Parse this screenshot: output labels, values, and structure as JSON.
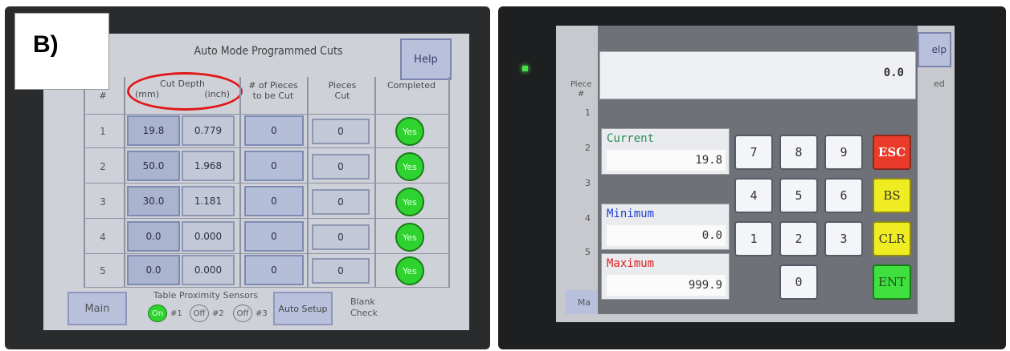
{
  "figure_label": "B)",
  "left_screen": {
    "title": "Auto Mode Programmed Cuts",
    "help_label": "Help",
    "header_row_col": "e\n#",
    "header_cut_depth": "Cut Depth",
    "header_mm": "(mm)",
    "header_inch": "(inch)",
    "header_pieces_to_cut": "# of Pieces\nto be Cut",
    "header_pieces_cut": "Pieces\nCut",
    "header_completed": "Completed",
    "rows": [
      {
        "num": "1",
        "mm": "19.8",
        "inch": "0.779",
        "to_cut": "0",
        "cut": "0",
        "completed": "Yes"
      },
      {
        "num": "2",
        "mm": "50.0",
        "inch": "1.968",
        "to_cut": "0",
        "cut": "0",
        "completed": "Yes"
      },
      {
        "num": "3",
        "mm": "30.0",
        "inch": "1.181",
        "to_cut": "0",
        "cut": "0",
        "completed": "Yes"
      },
      {
        "num": "4",
        "mm": "0.0",
        "inch": "0.000",
        "to_cut": "0",
        "cut": "0",
        "completed": "Yes"
      },
      {
        "num": "5",
        "mm": "0.0",
        "inch": "0.000",
        "to_cut": "0",
        "cut": "0",
        "completed": "Yes"
      }
    ],
    "main_label": "Main",
    "sensors_title": "Table Proximity Sensors",
    "sensor1_state": "On",
    "sensor1_label": "#1",
    "sensor2_state": "Off",
    "sensor2_label": "#2",
    "sensor3_state": "Off",
    "sensor3_label": "#3",
    "auto_setup_label": "Auto Setup",
    "blank_check_line1": "Blank",
    "blank_check_line2": "Check"
  },
  "right_screen": {
    "display_value": "0.0",
    "help_fragment": "elp",
    "side_piece_line1": "Piece",
    "side_piece_line2": "#",
    "side_completed_fragment": "ed",
    "side_rows": [
      "1",
      "2",
      "3",
      "4",
      "5"
    ],
    "main_fragment": "Ma",
    "current_label": "Current",
    "current_value": "19.8",
    "minimum_label": "Minimum",
    "minimum_value": "0.0",
    "maximum_label": "Maximum",
    "maximum_value": "999.9",
    "keys": {
      "k7": "7",
      "k8": "8",
      "k9": "9",
      "k4": "4",
      "k5": "5",
      "k6": "6",
      "k1": "1",
      "k2": "2",
      "k3": "3",
      "k0": "0",
      "esc": "ESC",
      "bs": "BS",
      "clr": "CLR",
      "ent": "ENT"
    }
  },
  "colors": {
    "current_label": "#2e8b57",
    "minimum_label": "#1f3fd0",
    "maximum_label": "#e02020",
    "highlight_circle": "#e01818",
    "yes_green": "#2fd32f"
  }
}
